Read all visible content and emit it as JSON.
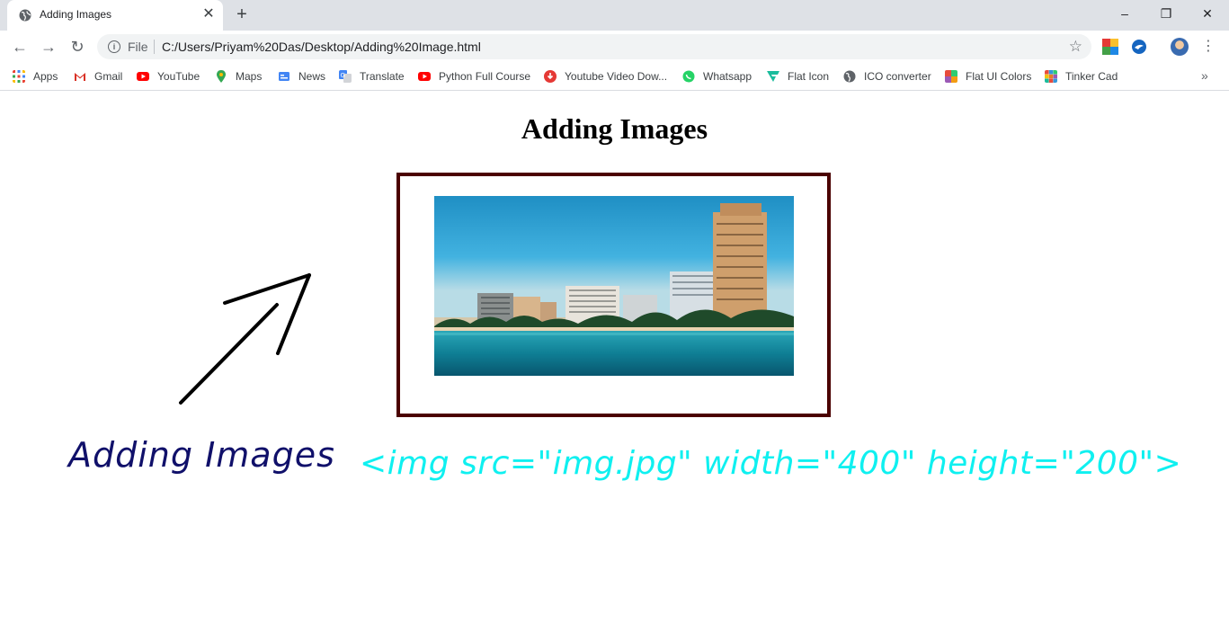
{
  "browser": {
    "tab_title": "Adding Images",
    "tab_close": "✕",
    "new_tab": "+",
    "window_controls": {
      "minimize": "–",
      "restore": "❐",
      "close": "✕"
    },
    "omnibox": {
      "scheme_label": "File",
      "url": "C:/Users/Priyam%20Das/Desktop/Adding%20Image.html"
    },
    "bookmarks": [
      {
        "label": "Apps",
        "icon": "apps-grid-icon",
        "color": "#ea4335"
      },
      {
        "label": "Gmail",
        "icon": "gmail-icon",
        "color": "#d93025"
      },
      {
        "label": "YouTube",
        "icon": "youtube-icon",
        "color": "#ff0000"
      },
      {
        "label": "Maps",
        "icon": "maps-pin-icon",
        "color": "#34a853"
      },
      {
        "label": "News",
        "icon": "news-icon",
        "color": "#4285f4"
      },
      {
        "label": "Translate",
        "icon": "translate-icon",
        "color": "#4285f4"
      },
      {
        "label": "Python Full Course",
        "icon": "youtube-icon",
        "color": "#ff0000"
      },
      {
        "label": "Youtube Video Dow...",
        "icon": "download-icon",
        "color": "#e53935"
      },
      {
        "label": "Whatsapp",
        "icon": "whatsapp-icon",
        "color": "#25d366"
      },
      {
        "label": "Flat Icon",
        "icon": "flaticon-icon",
        "color": "#1abc9c"
      },
      {
        "label": "ICO converter",
        "icon": "globe-icon",
        "color": "#5f6368"
      },
      {
        "label": "Flat UI Colors",
        "icon": "color-palette-icon",
        "color": "#e67e22"
      },
      {
        "label": "Tinker Cad",
        "icon": "tinkercad-icon",
        "color": "#e74c3c"
      }
    ],
    "bookmarks_more": "»"
  },
  "page": {
    "heading": "Adding Images",
    "frame_border_color": "#4b0000",
    "annotation_label": "Adding Images",
    "annotation_code": "<img src=\"img.jpg\" width=\"400\" height=\"200\">",
    "annotation_label_color": "#10106a",
    "annotation_code_color": "#0ff0f0"
  }
}
